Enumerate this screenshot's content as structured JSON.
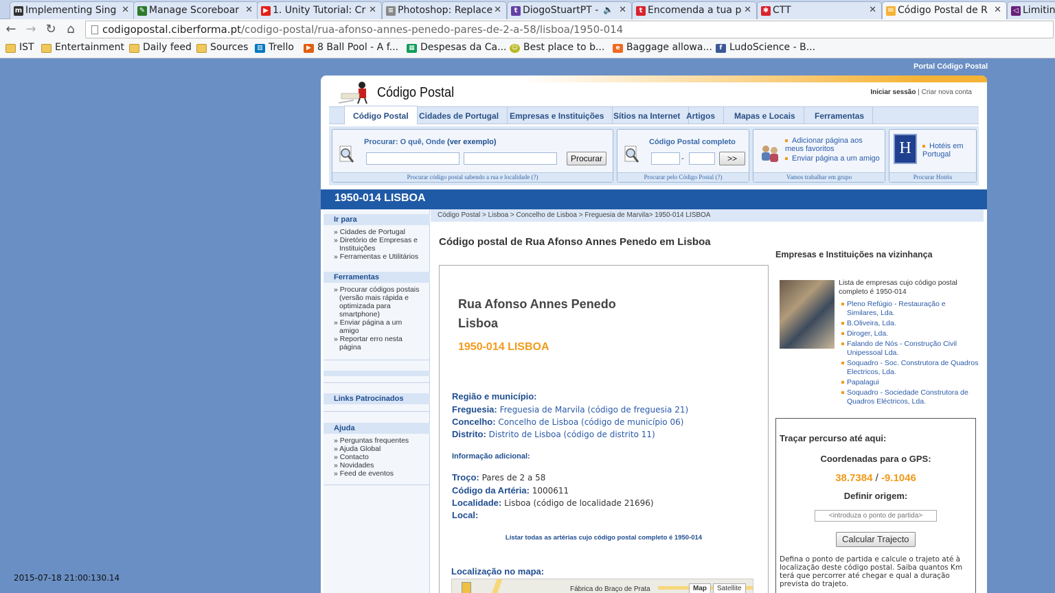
{
  "browser": {
    "tabs": [
      {
        "label": "Implementing Sing",
        "icon": "m-icon",
        "color": "#333333"
      },
      {
        "label": "Manage Scoreboar",
        "icon": "scoreboard-icon",
        "color": "#2b7a2b"
      },
      {
        "label": "1. Unity Tutorial: Cr",
        "icon": "youtube-icon",
        "color": "#e62117"
      },
      {
        "label": "Photoshop: Replace",
        "icon": "stackexchange-icon",
        "color": "#6a6a6a"
      },
      {
        "label": "DiogoStuartPT -",
        "icon": "twitch-icon",
        "color": "#6441a5"
      },
      {
        "label": "Encomenda a tua p",
        "icon": "t-icon",
        "color": "#d9232e"
      },
      {
        "label": "CTT",
        "icon": "ctt-icon",
        "color": "#d9232e"
      },
      {
        "label": "Código Postal de R",
        "icon": "codigo-postal-icon",
        "color": "#f5b335"
      },
      {
        "label": "Limitin",
        "icon": "visualstudio-icon",
        "color": "#68217a"
      }
    ],
    "url_host": "codigopostal.ciberforma.pt",
    "url_path": "/codigo-postal/rua-afonso-annes-penedo-pares-de-2-a-58/lisboa/1950-014",
    "bookmarks": [
      {
        "label": "IST",
        "icon": "folder-icon"
      },
      {
        "label": "Entertainment",
        "icon": "folder-icon"
      },
      {
        "label": "Daily feed",
        "icon": "folder-icon"
      },
      {
        "label": "Sources",
        "icon": "folder-icon"
      },
      {
        "label": "Trello",
        "icon": "trello-icon"
      },
      {
        "label": "8 Ball Pool - A f...",
        "icon": "8ball-icon"
      },
      {
        "label": "Despesas da Ca...",
        "icon": "sheets-icon"
      },
      {
        "label": "Best place to b...",
        "icon": "smiley-icon"
      },
      {
        "label": "Baggage allowa...",
        "icon": "e-icon"
      },
      {
        "label": "LudoScience - B...",
        "icon": "facebook-icon"
      }
    ]
  },
  "site": {
    "portal_link": "Portal Código Postal",
    "logo_text": "Código Postal",
    "login": "Iniciar sessão",
    "register": "Criar nova conta",
    "nav": [
      "Código Postal",
      "Cidades de Portugal",
      "Empresas e Instituições",
      "Sítios na Internet",
      "Artigos",
      "Mapas e Locais",
      "Ferramentas"
    ],
    "search": {
      "title": "Procurar: O quê, Onde",
      "example": "(ver exemplo)",
      "button": "Procurar",
      "foot": "Procurar código postal sabendo a rua e localidade (?)"
    },
    "cp_complete": {
      "title": "Código Postal completo",
      "dash": "-",
      "button": ">>",
      "foot": "Procurar pelo Código Postal (?)"
    },
    "group": {
      "link1": "Adicionar página aos meus favoritos",
      "link2": "Enviar página a um amigo",
      "foot": "Vamos trabalhar em grupo"
    },
    "hotels": {
      "link": "Hotéis em Portugal",
      "foot": "Procurar Hotéis",
      "badge": "H"
    },
    "page_title": "1950-014 LISBOA",
    "sidebar": {
      "goto_title": "Ir para",
      "goto_items": [
        "» Cidades de Portugal",
        "» Diretório de Empresas e Instituições",
        "» Ferramentas e Utilitários"
      ],
      "tools_title": "Ferramentas",
      "tools_items": [
        "» Procurar códigos postais (versão mais rápida e optimizada para smartphone)",
        "» Enviar página a um amigo",
        "» Reportar erro nesta página"
      ],
      "sponsored": "Links Patrocinados",
      "help_title": "Ajuda",
      "help_items": [
        "» Perguntas frequentes",
        "» Ajuda Global",
        "» Contacto",
        "» Novidades",
        "» Feed de eventos"
      ]
    },
    "breadcrumb": "Código Postal > Lisboa > Concelho de Lisboa > Freguesia de Marvila> 1950-014 LISBOA",
    "heading": "Código postal de Rua Afonso Annes Penedo em Lisboa",
    "street_line1": "Rua Afonso Annes Penedo",
    "street_line2": "Lisboa",
    "postal_code": "1950-014 LISBOA",
    "region_title": "Região e município:",
    "freguesia_label": "Freguesia:",
    "freguesia_value": "Freguesia de Marvila (código de freguesia 21)",
    "concelho_label": "Concelho:",
    "concelho_value": "Concelho de Lisboa (código de município 06)",
    "distrito_label": "Distrito:",
    "distrito_value": "Distrito de Lisboa (código de distrito 11)",
    "extra_title": "Informação adicional:",
    "troco_label": "Troço:",
    "troco_value": "Pares de 2 a 58",
    "arteria_label": "Código da Artéria:",
    "arteria_value": "1000611",
    "localidade_label": "Localidade:",
    "localidade_value": "Lisboa (código de localidade 21696)",
    "local_label": "Local:",
    "list_link": "Listar todas as artérias cujo código postal completo é 1950-014",
    "map_title": "Localização no mapa:",
    "map_place": "Fábrica do Braço de Prata",
    "map_btn_map": "Map",
    "map_btn_sat": "Satellite",
    "nearby_title": "Empresas e Instituições na vizinhança",
    "nearby_desc": "Lista de empresas cujo código postal completo é 1950-014",
    "companies": [
      "Pleno Refúgio - Restauração e Similares, Lda.",
      "B.Oliveira, Lda.",
      "Diroger, Lda.",
      "Falando de Nós - Construção Civil Unipessoal Lda.",
      "Soquadro - Soc. Construtora de Quadros Electricos, Lda.",
      "Papalagui",
      "Soquadro - Sociedade Construtora de Quadros Eléctricos, Lda."
    ],
    "route": {
      "title": "Traçar percurso até aqui:",
      "gps_title": "Coordenadas para o GPS:",
      "lat": "38.7384",
      "sep": "/",
      "lon": "-9.1046",
      "origin_title": "Definir origem:",
      "placeholder": "<introduza o ponto de partida>",
      "button": "Calcular Trajecto",
      "desc": "Defina o ponto de partida e calcule o trajeto até à localização deste código postal. Saiba quantos Km terá que percorrer até chegar e qual a duração prevista do trajeto."
    }
  },
  "timestamp": "2015-07-18 21:00:130.14"
}
